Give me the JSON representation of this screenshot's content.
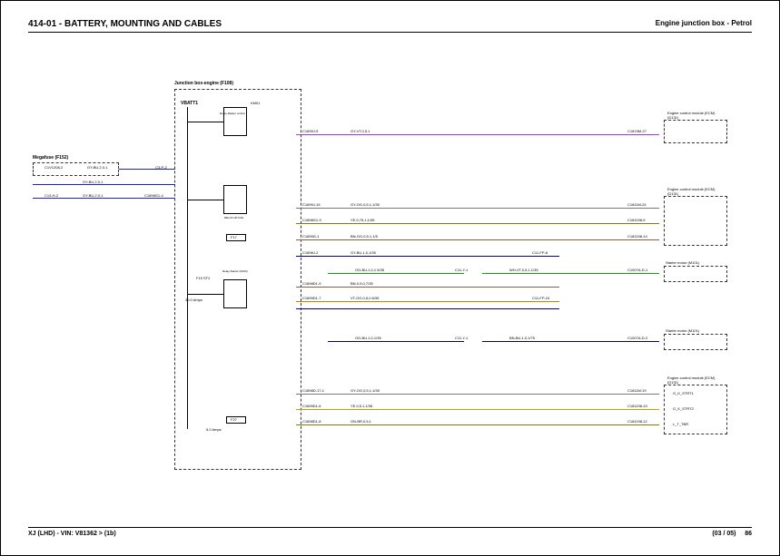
{
  "header": {
    "section": "414-01 - BATTERY, MOUNTING AND CABLES",
    "subtitle": "Engine junction box - Petrol"
  },
  "footer": {
    "vehicle": "XJ  (LHD) - VIN: V81362 >  (1b)",
    "page_of": "(03 / 05)",
    "page_num": "86"
  },
  "junction_box": {
    "title": "Junction box-engine (F108)",
    "vbatt": "VBATT1",
    "km01": "KM01"
  },
  "megafuse": {
    "title": "Megafuse (F152)",
    "c1": "C1V1208-2",
    "w1": "GY-BU,2,0,1",
    "c2": "C3-P-2"
  },
  "wires_in": {
    "w2": "GY-BU,2,0,1",
    "c3": "C13-H-2",
    "w3": "GY-BU,2,0,1",
    "c4": "C1898G1-4"
  },
  "relay1": {
    "name": "Relay-Master control",
    "sub": "",
    "c_out": "C1899J-5",
    "w_out": "GY-VT,0,5,1",
    "conn": "C1819M-27"
  },
  "ecm1": {
    "name": "Engine control module (ECM) (D131)"
  },
  "relay2": {
    "name": "Relay",
    "sub": "RELAY-HP FAN",
    "lines": [
      {
        "c1": "C1899J-15",
        "w": "GY-OG,0,5,1,1/35",
        "c2": "C1811M-24"
      },
      {
        "c1": "C1898G1-9",
        "w": "YE,0,75,1,1/35",
        "c2": "C181198-9"
      },
      {
        "c1": "C1899G-1",
        "w": "BN-OG,0,5,1,1/5",
        "c2": "C181198-14"
      }
    ]
  },
  "ecm2": {
    "name": "Engine control module (ECM) (D131)"
  },
  "f17": {
    "name": "F17",
    "c1": "C1898J-2",
    "w": "GY-BU,1,0,1/35",
    "c2": "C11-FP-8"
  },
  "starter1": {
    "name": "Starter motor (M101)",
    "top": {
      "w1": "OG-BU,1,0,1.5/35",
      "c1": "C11-Y-1",
      "w2": "WH-VT,0,5,1,1/35",
      "c2": "C1007A-D-1"
    }
  },
  "relay3": {
    "name": "Relay-Starter (R103)",
    "amps": "30.0 Amps",
    "f19": "F19   ST2",
    "lines": [
      {
        "c1": "C1898D1-9",
        "w": "BN-0,5,0,7/35"
      },
      {
        "c1": "C1899D1-7",
        "w": "VT-OG,0,5,0.6/35",
        "c2": "C11-FP-24"
      }
    ]
  },
  "starter2": {
    "name": "Starter motor (M101)",
    "line": {
      "w1": "OG-BU,1,0,1/35",
      "c1": "C11-Y-1",
      "w2": "BN-BU,1,0,1/75",
      "c2": "C1007A-D-2"
    }
  },
  "ecm3": {
    "name": "Engine control module (ECM) (D131)",
    "lines": [
      {
        "c1": "C1898D-17-1",
        "w": "GY-OG,0,5,1,1/35",
        "c2": "C1811M-19",
        "sig": "G_K_STRT1"
      },
      {
        "c1": "C1899D1-6",
        "w": "YE,0,5,1,1/35",
        "c2": "C181198-19",
        "sig": "G_K_STRT2"
      },
      {
        "c1": "C1898D1-8",
        "w": "GN-BR,0,5,1",
        "c2": "C181198-12",
        "sig": "L_T_TBR"
      }
    ]
  },
  "f27": {
    "name": "F27",
    "amps": "5.0 Amps"
  }
}
